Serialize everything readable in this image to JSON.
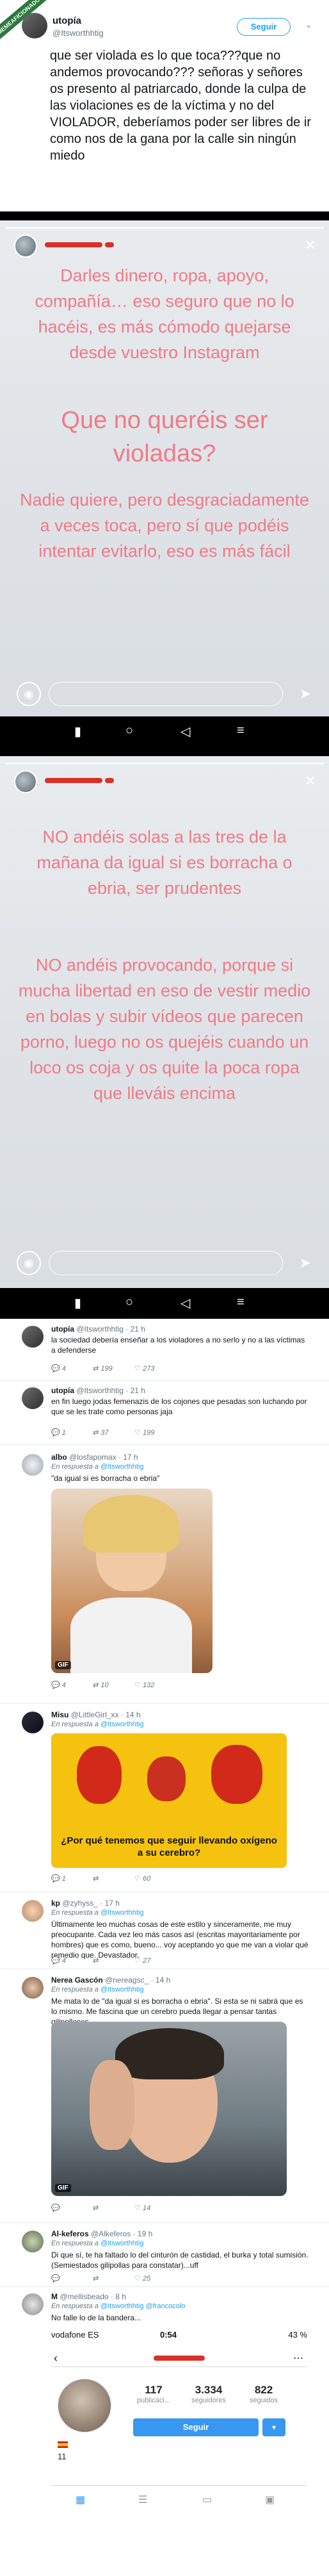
{
  "badge": "MEMEAFICIONADO",
  "tweet": {
    "name": "utopía",
    "handle": "@Itsworthhtig",
    "follow_label": "Seguir",
    "text": "que ser violada es lo que toca???que no andemos provocando??? señoras y señores os presento al patriarcado, donde la culpa de las violaciones es de la víctima y no del VIOLADOR, deberíamos poder ser libres de ir como nos de la gana por la calle sin ningún miedo"
  },
  "story1": {
    "text1": "Darles dinero, ropa, apoyo, compañía… eso seguro que no lo hacéis, es más cómodo quejarse desde vuestro Instagram",
    "text2": "Que no queréis ser violadas?",
    "text3": "Nadie quiere, pero desgraciadamente a veces toca, pero sí que podéis intentar evitarlo, eso es más fácil"
  },
  "story2": {
    "text1": "NO andéis solas a las tres de la mañana da igual si es borracha o ebria, ser prudentes",
    "text2": "NO andéis provocando, porque si mucha libertad en eso de vestir medio en bolas y subir vídeos que parecen porno, luego no os quejéis cuando un loco os coja y os quite la poca ropa que lleváis encima"
  },
  "replies": [
    {
      "name": "utopía",
      "handle": "@Itsworthhtig",
      "time": "21 h",
      "body": "la sociedad debería enseñar a los violadores a no serlo y no a las víctimas a defenderse",
      "reply": "4",
      "retweet": "199",
      "like": "273"
    },
    {
      "name": "utopía",
      "handle": "@Itsworthhtig",
      "time": "21 h",
      "body": "en fin luego jodas femenazis de los cojones que pesadas son luchando por que se les trate como personas jaja",
      "reply": "1",
      "retweet": "37",
      "like": "199"
    },
    {
      "name": "albo",
      "handle": "@losfapomax",
      "time": "17 h",
      "in_reply": "En respuesta a",
      "mention": "@Itsworthhtig",
      "body": "\"da igual si es borracha o ebria\"",
      "gif": "GIF",
      "reply": "4",
      "retweet": "10",
      "like": "132"
    },
    {
      "name": "Misu",
      "handle": "@LittleGirl_xx",
      "time": "14 h",
      "in_reply": "En respuesta a",
      "mention": "@Itsworthhtig",
      "meme_caption": "¿Por qué tenemos que seguir llevando oxígeno a su cerebro?",
      "reply": "1",
      "retweet": "",
      "like": "60"
    },
    {
      "name": "kp",
      "handle": "@zyhyss_",
      "time": "17 h",
      "in_reply": "En respuesta a",
      "mention": "@Itsworthhtig",
      "body": "Últimamente leo muchas cosas de este estilo y sinceramente, me muy preocupante. Cada vez leo más casos así (escritas mayoritariamente por hombres) que es como, bueno... voy aceptando yo que me van a violar qué remedio que. Devastador.",
      "reply": "4",
      "retweet": "",
      "like": "27"
    },
    {
      "name": "Nerea Gascón",
      "handle": "@nereagsc_",
      "time": "14 h",
      "in_reply": "En respuesta a",
      "mention": "@Itsworthhtig",
      "body": "Me mata lo de \"da igual si es borracha o ebria\". Si esta se ni sabrá que es lo mismo. Me fascina que un cerebro pueda llegar a pensar tantas gilipolleces.",
      "gif": "GIF",
      "reply": "",
      "retweet": "",
      "like": "14"
    },
    {
      "name": "Al-keferos",
      "handle": "@Alkeferos",
      "time": "19 h",
      "in_reply": "En respuesta a",
      "mention": "@Itsworthhtig",
      "body": "Di que sí, te ha faltado lo del cinturón de castidad, el burka y total sumisión. (Semiestados gilipollas para constatar)...uff",
      "reply": "",
      "retweet": "",
      "like": "25"
    },
    {
      "name": "M",
      "handle": "@mellisbeado",
      "time": "8 h",
      "in_reply": "En respuesta a",
      "mention": "@Itsworthhtig @francocolo",
      "body": "No falle lo de la bandera..."
    }
  ],
  "ig": {
    "carrier": "vodafone ES",
    "time": "0:54",
    "battery": "43 %",
    "posts": "117",
    "posts_label": "publicaci...",
    "followers": "3.334",
    "followers_label": "seguidores",
    "following": "822",
    "following_label": "seguidos",
    "follow_label": "Seguir",
    "bio_number": "11"
  }
}
